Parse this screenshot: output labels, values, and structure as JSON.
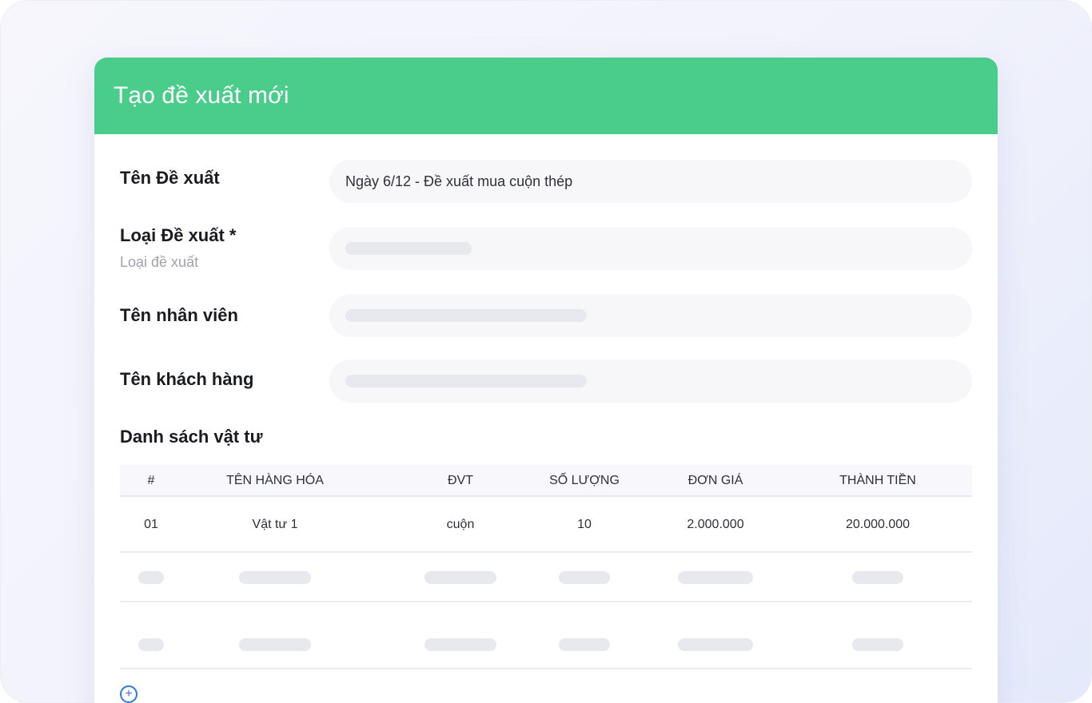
{
  "dialog": {
    "title": "Tạo đề xuất mới"
  },
  "form": {
    "name": {
      "label": "Tên Đề xuất",
      "value": "Ngày 6/12 -  Đề xuất mua cuộn thép"
    },
    "type": {
      "label": "Loại Đề xuất *",
      "sublabel": "Loại đề xuất"
    },
    "employee": {
      "label": "Tên nhân viên"
    },
    "customer": {
      "label": "Tên khách hàng"
    }
  },
  "materials": {
    "title": "Danh sách vật tư",
    "columns": [
      "#",
      "TÊN HÀNG HÓA",
      "ĐVT",
      "SỐ LƯỢNG",
      "ĐƠN GIÁ",
      "THÀNH TIỀN"
    ],
    "rows": [
      [
        "01",
        "Vật tư 1",
        "cuộn",
        "10",
        "2.000.000",
        "20.000.000"
      ]
    ],
    "placeholder_rows": 2
  },
  "icons": {
    "add": "plus-circle-icon"
  },
  "colors": {
    "header": "#4acd8b",
    "link": "#2d7be0"
  }
}
